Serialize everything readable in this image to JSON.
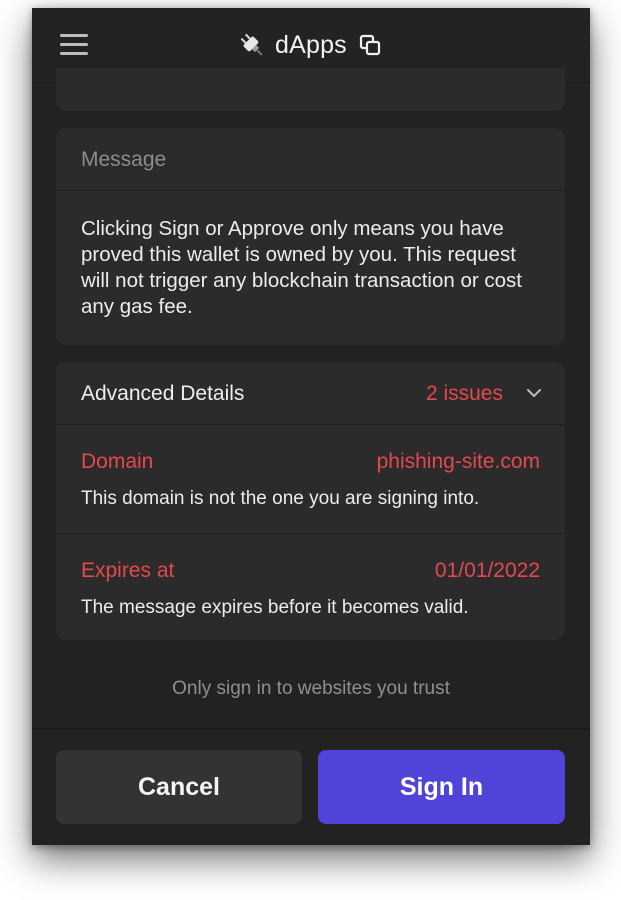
{
  "header": {
    "title": "dApps",
    "icons": {
      "menu": "hamburger-menu-icon",
      "logo": "plug-icon",
      "copy": "copy-icon"
    }
  },
  "message": {
    "label": "Message",
    "text": "Clicking Sign or Approve only means you have proved this wallet is owned by you. This request will not trigger any blockchain transaction or cost any gas fee."
  },
  "advanced": {
    "title": "Advanced Details",
    "issues": "2 issues",
    "rows": [
      {
        "label": "Domain",
        "value": "phishing-site.com",
        "description": "This domain is not the one you are signing into."
      },
      {
        "label": "Expires at",
        "value": "01/01/2022",
        "description": "The message expires before it becomes valid."
      }
    ]
  },
  "notice": "Only sign in to websites you trust",
  "buttons": {
    "cancel": "Cancel",
    "sign_in": "Sign In"
  },
  "colors": {
    "background": "#222222",
    "card": "#2b2b2b",
    "warning": "#e5484d",
    "primary": "#5043d8"
  }
}
